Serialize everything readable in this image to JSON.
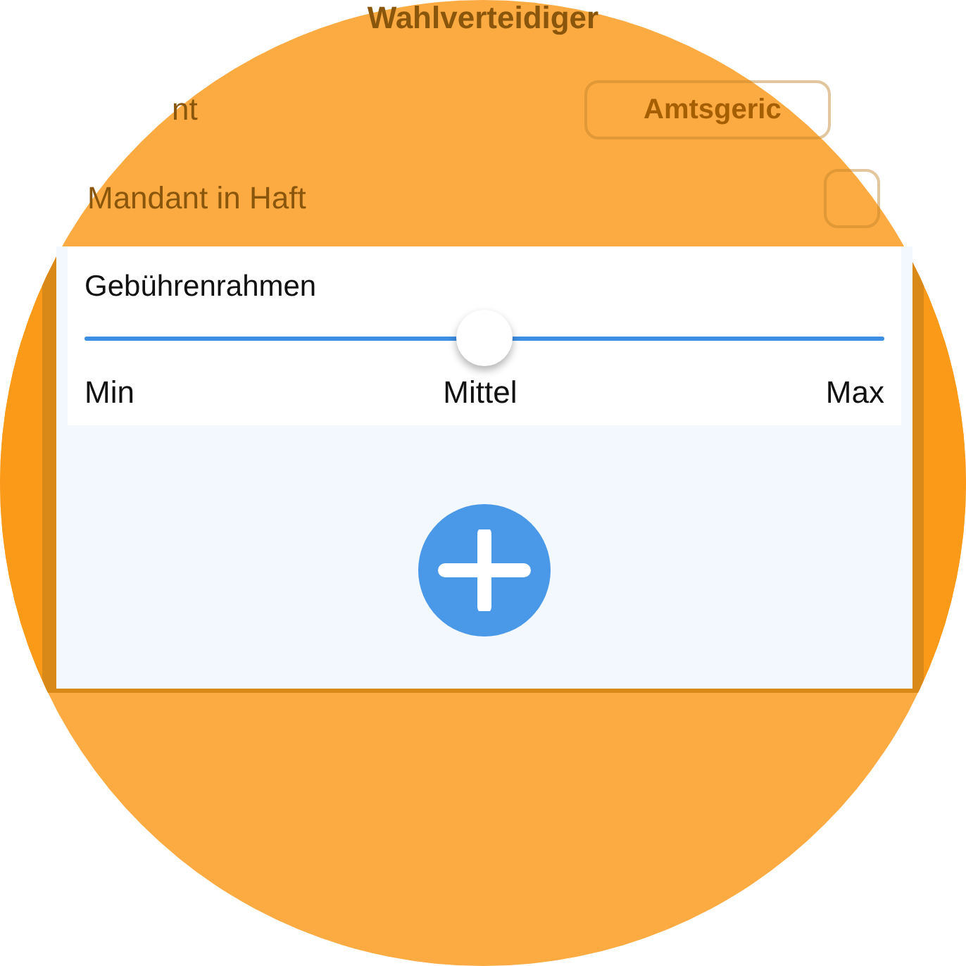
{
  "background_form": {
    "title": "Wahlverteidiger",
    "rows": [
      {
        "kind": "select",
        "label": "nt",
        "value": "Amtsgeric"
      },
      {
        "kind": "checkbox",
        "label": "Mandant in Haft",
        "checked": false
      }
    ]
  },
  "fee_panel": {
    "title": "Gebührenrahmen",
    "slider": {
      "level": 0.5
    },
    "labels": [
      "Min",
      "Mittel",
      "Max"
    ]
  }
}
